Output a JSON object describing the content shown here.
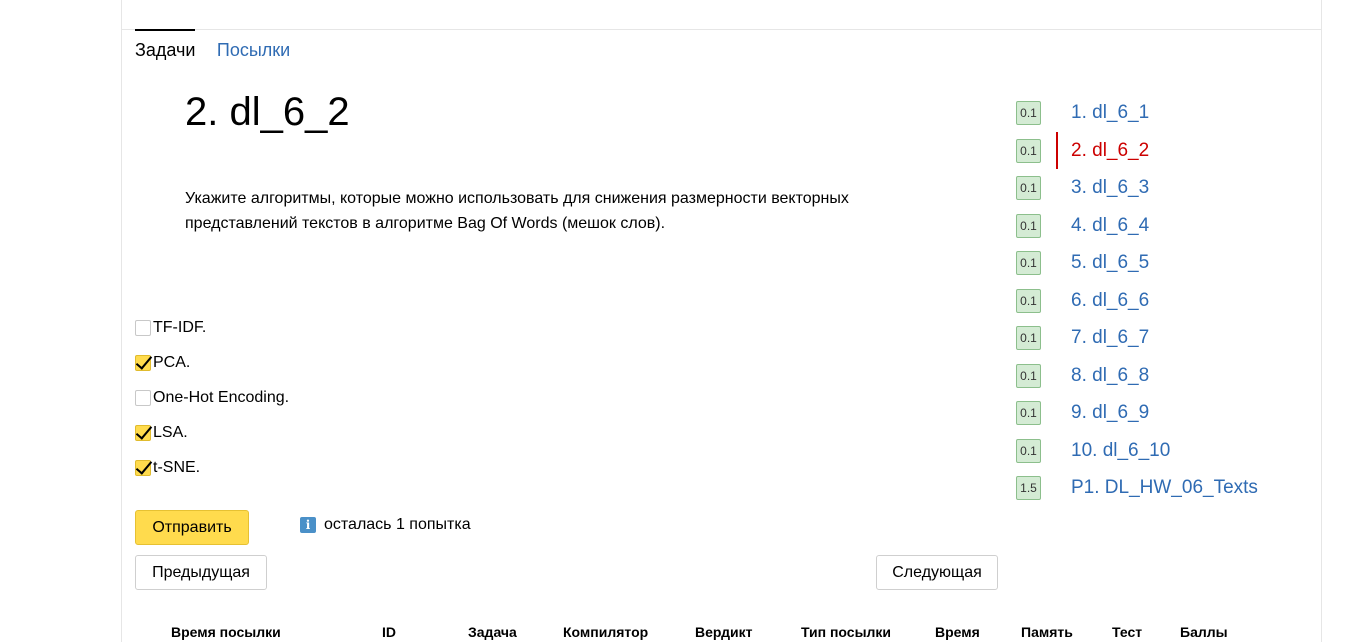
{
  "tabs": [
    {
      "label": "Задачи",
      "active": true
    },
    {
      "label": "Посылки",
      "active": false
    }
  ],
  "problem": {
    "title": "2. dl_6_2",
    "statement": "Укажите алгоритмы, которые можно использовать для снижения размерности векторных представлений текстов в алгоритме Bag Of Words (мешок слов).",
    "options": [
      {
        "label": "TF-IDF.",
        "checked": false
      },
      {
        "label": "PCA.",
        "checked": true
      },
      {
        "label": "One-Hot Encoding.",
        "checked": false
      },
      {
        "label": "LSA.",
        "checked": true
      },
      {
        "label": "t-SNE.",
        "checked": true
      }
    ]
  },
  "actions": {
    "submit_label": "Отправить",
    "attempts_text": "осталась 1 попытка",
    "info_icon": "i",
    "prev_label": "Предыдущая",
    "next_label": "Следующая"
  },
  "results_table": {
    "headers": [
      "Время посылки",
      "ID",
      "Задача",
      "Компилятор",
      "Вердикт",
      "Тип посылки",
      "Время",
      "Память",
      "Тест",
      "Баллы"
    ]
  },
  "problem_list": [
    {
      "score": "0.1",
      "label": "1. dl_6_1",
      "current": false
    },
    {
      "score": "0.1",
      "label": "2. dl_6_2",
      "current": true
    },
    {
      "score": "0.1",
      "label": "3. dl_6_3",
      "current": false
    },
    {
      "score": "0.1",
      "label": "4. dl_6_4",
      "current": false
    },
    {
      "score": "0.1",
      "label": "5. dl_6_5",
      "current": false
    },
    {
      "score": "0.1",
      "label": "6. dl_6_6",
      "current": false
    },
    {
      "score": "0.1",
      "label": "7. dl_6_7",
      "current": false
    },
    {
      "score": "0.1",
      "label": "8. dl_6_8",
      "current": false
    },
    {
      "score": "0.1",
      "label": "9. dl_6_9",
      "current": false
    },
    {
      "score": "0.1",
      "label": "10. dl_6_10",
      "current": false
    },
    {
      "score": "1.5",
      "label": "P1. DL_HW_06_Texts",
      "current": false
    }
  ],
  "colors": {
    "accent_yellow": "#ffdb4d",
    "link_blue": "#2f6bb3",
    "current_red": "#cc0000",
    "badge_green": "#d4ebd4"
  }
}
